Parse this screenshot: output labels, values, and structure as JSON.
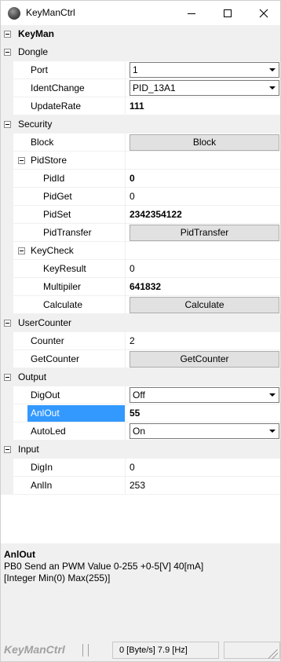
{
  "window": {
    "title": "KeyManCtrl"
  },
  "grid": {
    "root": "KeyMan",
    "dongle": {
      "label": "Dongle",
      "port_label": "Port",
      "port_value": "1",
      "identchange_label": "IdentChange",
      "identchange_value": "PID_13A1",
      "updaterate_label": "UpdateRate",
      "updaterate_value": "111"
    },
    "security": {
      "label": "Security",
      "block_label": "Block",
      "block_button": "Block"
    },
    "pidstore": {
      "label": "PidStore",
      "pidid_label": "PidId",
      "pidid_value": "0",
      "pidget_label": "PidGet",
      "pidget_value": "0",
      "pidset_label": "PidSet",
      "pidset_value": "2342354122",
      "pidtransfer_label": "PidTransfer",
      "pidtransfer_button": "PidTransfer"
    },
    "keycheck": {
      "label": "KeyCheck",
      "keyresult_label": "KeyResult",
      "keyresult_value": "0",
      "multipiler_label": "Multipiler",
      "multipiler_value": "641832",
      "calculate_label": "Calculate",
      "calculate_button": "Calculate"
    },
    "usercounter": {
      "label": "UserCounter",
      "counter_label": "Counter",
      "counter_value": "2",
      "getcounter_label": "GetCounter",
      "getcounter_button": "GetCounter"
    },
    "output": {
      "label": "Output",
      "digout_label": "DigOut",
      "digout_value": "Off",
      "anlout_label": "AnlOut",
      "anlout_value": "55",
      "autoled_label": "AutoLed",
      "autoled_value": "On"
    },
    "input": {
      "label": "Input",
      "digin_label": "DigIn",
      "digin_value": "0",
      "anlin_label": "AnlIn",
      "anlin_value": "253"
    }
  },
  "help": {
    "title": "AnlOut",
    "line1": "PB0 Send an PWM Value 0-255 +0-5[V] 40[mA]",
    "line2": "[Integer Min(0) Max(255)]"
  },
  "status": {
    "brand": "KeyManCtrl",
    "rate": "0 [Byte/s]  7.9 [Hz]"
  },
  "colors": {
    "selection": "#3399ff",
    "category_bg": "#f0f0f0"
  }
}
